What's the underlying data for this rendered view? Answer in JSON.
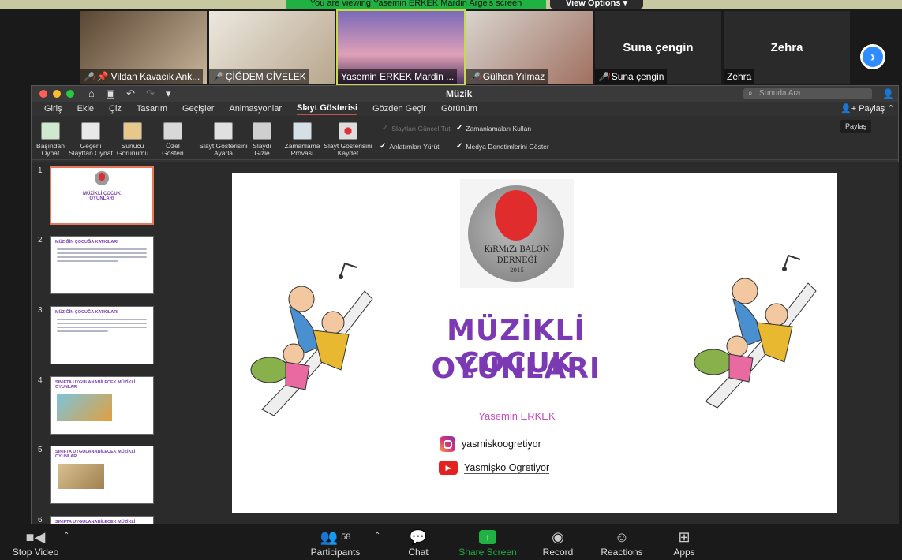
{
  "banner": {
    "text": "You are viewing Yasemin ERKEK Mardin Arge's screen",
    "view_options": "View Options ▾"
  },
  "participants": [
    {
      "name": "Vildan Kavacık Ank...",
      "muted": true,
      "pinned": true
    },
    {
      "name": "ÇİĞDEM CİVELEK",
      "muted": true
    },
    {
      "name": "Yasemin ERKEK Mardin ...",
      "muted": false
    },
    {
      "name": "Gülhan Yılmaz",
      "muted": true
    },
    {
      "name": "Suna çengin",
      "big": "Suna çengin",
      "muted": true
    },
    {
      "name": "Zehra",
      "big": "Zehra",
      "muted": false
    }
  ],
  "ppt": {
    "title": "Müzik",
    "search_placeholder": "Sunuda Ara",
    "tabs": [
      "Giriş",
      "Ekle",
      "Çiz",
      "Tasarım",
      "Geçişler",
      "Animasyonlar",
      "Slayt Gösterisi",
      "Gözden Geçir",
      "Görünüm"
    ],
    "active_tab": "Slayt Gösterisi",
    "share": "Paylaş",
    "tooltip": "Paylaş",
    "ribbon": {
      "b1": "Başından\nOynat",
      "b2": "Geçerli\nSlayttan Oynat",
      "b3": "Sunucu\nGörünümü",
      "b4": "Özel\nGösteri",
      "b5": "Slayt Gösterisini\nAyarla",
      "b6": "Slaydı\nGizle",
      "b7": "Zamanlama\nProvası",
      "b8": "Slayt Gösterisini\nKaydet",
      "c1": "Slaytları Güncel Tut",
      "c2": "Zamanlamaları Kullan",
      "c3": "Anlatımları Yürüt",
      "c4": "Medya Denetimlerini Göster"
    },
    "thumbs": [
      {
        "num": "1",
        "title": "MÜZİKLİ ÇOCUK OYUNLARI"
      },
      {
        "num": "2",
        "title": "MÜZİĞİN ÇOCUĞA KATKILARI"
      },
      {
        "num": "3",
        "title": "MÜZİĞİN ÇOCUĞA KATKILARI"
      },
      {
        "num": "4",
        "title": "SINIFTA UYGULANABİLECEK MÜZİKLİ OYUNLAR"
      },
      {
        "num": "5",
        "title": "SINIFTA UYGULANABİLECEK MÜZİKLİ OYUNLAR"
      },
      {
        "num": "6",
        "title": "SINIFTA UYGULANABİLECEK MÜZİKLİ"
      }
    ],
    "slide": {
      "logo_line1": "KıRMıZı BALON",
      "logo_line2": "DERNEĞİ",
      "logo_year": "2015",
      "title_line1": "MÜZİKLİ ÇOCUK",
      "title_line2": "OYUNLARI",
      "author": "Yasemin ERKEK",
      "instagram": "yasmiskoogretiyor",
      "youtube": "Yasmişko Ogretiyor"
    }
  },
  "toolbar": {
    "stop_video": "Stop Video",
    "participants": "Participants",
    "participants_count": "58",
    "chat": "Chat",
    "share_screen": "Share Screen",
    "record": "Record",
    "reactions": "Reactions",
    "apps": "Apps"
  },
  "colors": {
    "accent_purple": "#7b3ab3",
    "zoom_green": "#1fb141",
    "zoom_blue": "#2d8cff"
  }
}
